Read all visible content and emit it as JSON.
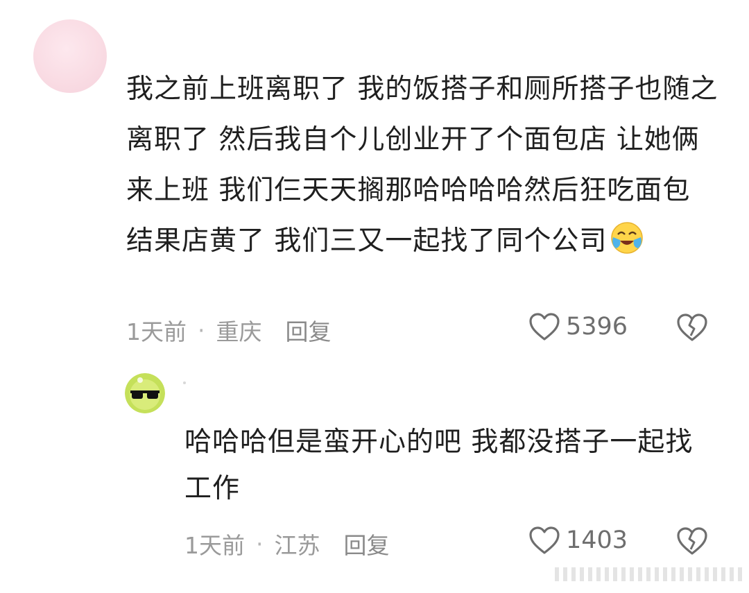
{
  "comments": [
    {
      "text": "我之前上班离职了 我的饭搭子和厕所搭子也随之离职了 然后我自个儿创业开了个面包店 让她俩来上班 我们仨天天搁那哈哈哈哈然后狂吃面包 结果店黄了 我们三又一起找了同个公司",
      "emoji": "crying-laughing-emoji",
      "time": "1天前",
      "separator": "·",
      "location": "重庆",
      "reply_label": "回复",
      "likes": "5396"
    },
    {
      "text": "哈哈哈但是蛮开心的吧  我都没搭子一起找工作",
      "time": "1天前",
      "separator": "·",
      "location": "江苏",
      "reply_label": "回复",
      "likes": "1403"
    }
  ],
  "colors": {
    "meta_text": "#9a9a9a",
    "avatar_pink": "#f9dbe3",
    "avatar_green": "#c5e05a"
  }
}
